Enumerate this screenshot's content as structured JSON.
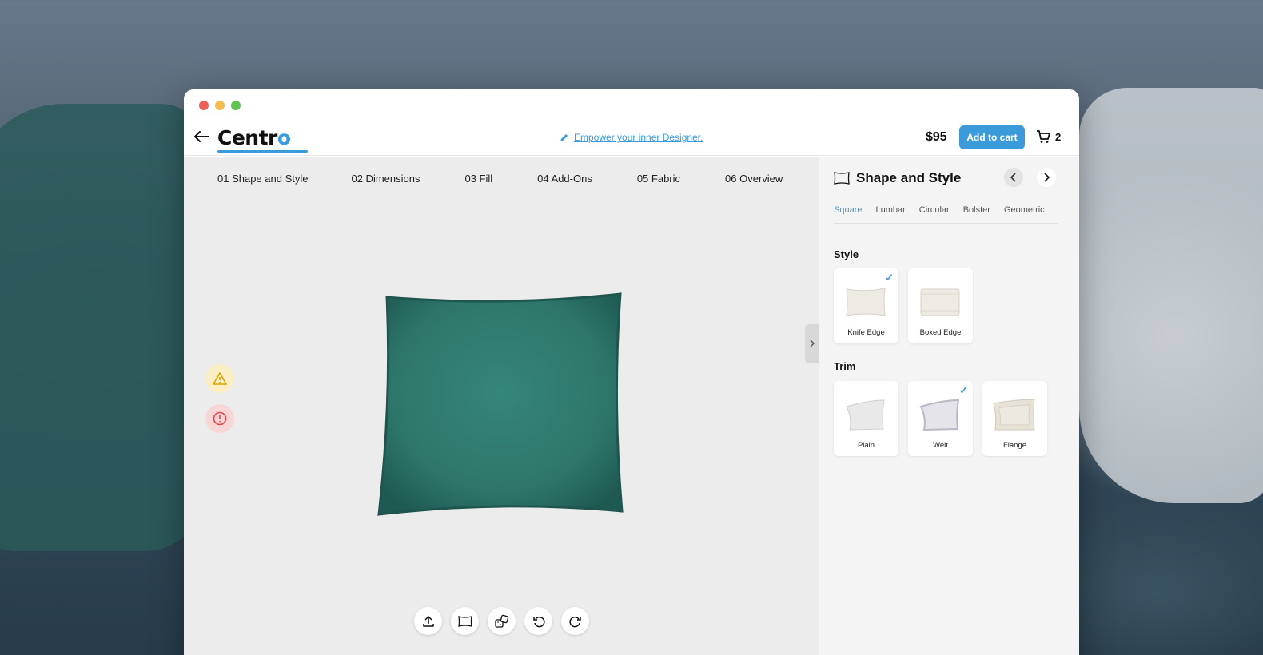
{
  "window": {
    "controls": [
      "close",
      "minimize",
      "zoom"
    ]
  },
  "header": {
    "back_icon": "arrow-left-icon",
    "logo": {
      "prefix": "Centr",
      "accent": "o"
    },
    "tagline": "Empower your inner Designer.",
    "price": "$95",
    "add_to_cart": "Add to cart",
    "cart_count": "2"
  },
  "steps": [
    {
      "label": "01 Shape and Style",
      "active": true
    },
    {
      "label": "02 Dimensions"
    },
    {
      "label": "03 Fill"
    },
    {
      "label": "04 Add-Ons"
    },
    {
      "label": "05 Fabric"
    },
    {
      "label": "06 Overview"
    }
  ],
  "panel": {
    "title": "Shape and Style",
    "shape_tabs": [
      "Square",
      "Lumbar",
      "Circular",
      "Bolster",
      "Geometric"
    ],
    "active_shape": "Square",
    "style_heading": "Style",
    "styles": [
      {
        "label": "Knife Edge",
        "selected": true
      },
      {
        "label": "Boxed Edge",
        "selected": false
      }
    ],
    "trim_heading": "Trim",
    "trims": [
      {
        "label": "Plain",
        "selected": false
      },
      {
        "label": "Welt",
        "selected": true
      },
      {
        "label": "Flange",
        "selected": false
      }
    ]
  },
  "colors": {
    "accent": "#3b9ad9",
    "pillow": "#2f7a6f",
    "warning": "#f5b300",
    "error": "#e2424a"
  }
}
